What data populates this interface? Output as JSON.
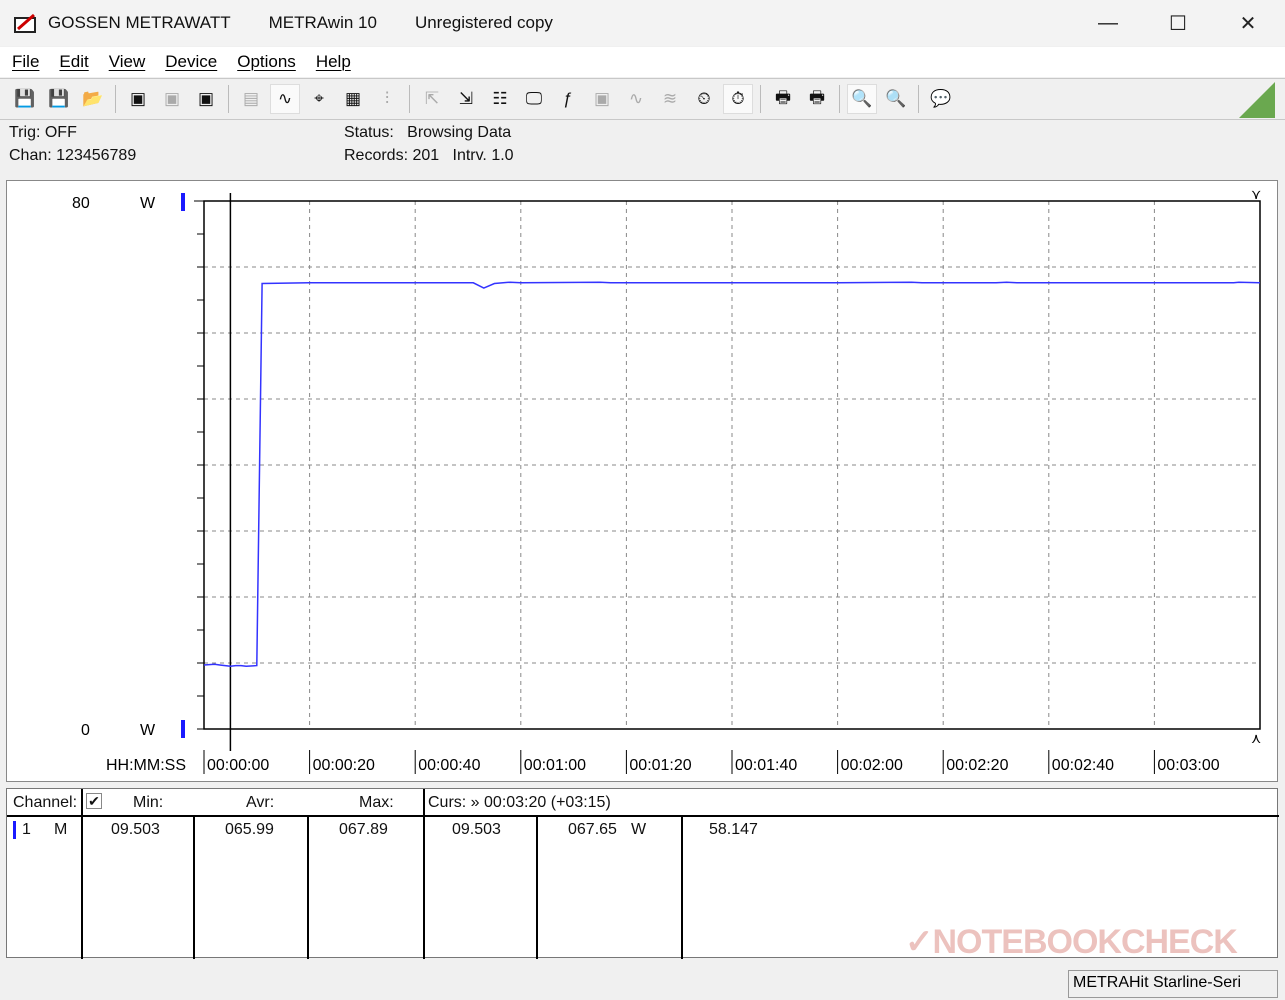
{
  "window": {
    "brand": "GOSSEN METRAWATT",
    "app": "METRAwin 10",
    "registration": "Unregistered copy"
  },
  "menu": [
    "File",
    "Edit",
    "View",
    "Device",
    "Options",
    "Help"
  ],
  "toolbar": [
    {
      "icon": "save-export-icon",
      "glyph": "💾"
    },
    {
      "icon": "save-import-icon",
      "glyph": "💾"
    },
    {
      "icon": "open-folder-icon",
      "glyph": "📂"
    },
    "sep",
    {
      "icon": "device-read-icon",
      "glyph": "▣"
    },
    {
      "icon": "device-read-disabled-icon",
      "glyph": "▣",
      "disabled": true
    },
    {
      "icon": "device-memory-icon",
      "glyph": "▣"
    },
    "sep",
    {
      "icon": "numeric-display-icon",
      "glyph": "▤",
      "disabled": true
    },
    {
      "icon": "waveform-chart-icon",
      "glyph": "∿",
      "active": true
    },
    {
      "icon": "crosshair-cursor-icon",
      "glyph": "⌖"
    },
    {
      "icon": "table-view-icon",
      "glyph": "▦"
    },
    {
      "icon": "histogram-icon",
      "glyph": "⫶",
      "disabled": true
    },
    "sep",
    {
      "icon": "transfer-out-icon",
      "glyph": "⇱",
      "disabled": true
    },
    {
      "icon": "transfer-in-icon",
      "glyph": "⇲"
    },
    {
      "icon": "settings-list-icon",
      "glyph": "☷"
    },
    {
      "icon": "monitor-icon",
      "glyph": "🖵"
    },
    {
      "icon": "formula-icon",
      "glyph": "ƒ"
    },
    {
      "icon": "device-settings-icon",
      "glyph": "▣",
      "disabled": true
    },
    {
      "icon": "trigger-wave-icon",
      "glyph": "∿",
      "disabled": true
    },
    {
      "icon": "signal-wave-icon",
      "glyph": "≋",
      "disabled": true
    },
    {
      "icon": "clock-timer-icon",
      "glyph": "⏲"
    },
    {
      "icon": "record-stopwatch-icon",
      "glyph": "⏱",
      "active": true
    },
    "sep",
    {
      "icon": "print-chart-icon",
      "glyph": "🖶"
    },
    {
      "icon": "print-icon",
      "glyph": "🖶"
    },
    "sep",
    {
      "icon": "zoom-wave-icon",
      "glyph": "🔍",
      "active": true
    },
    {
      "icon": "zoom-peak-icon",
      "glyph": "🔍"
    },
    "sep",
    {
      "icon": "help-comment-icon",
      "glyph": "💬"
    }
  ],
  "info": {
    "trig": "Trig: OFF",
    "chan": "Chan:  123456789",
    "status": "Status:   Browsing Data",
    "records": "Records: 201   Intrv. 1.0"
  },
  "chart_data": {
    "type": "line",
    "ylim": [
      0,
      80
    ],
    "y_top_label": "80",
    "y_bottom_label": "0",
    "y_unit": "W",
    "xlabel": "HH:MM:SS",
    "xlim": [
      0,
      200
    ],
    "x_ticks": [
      "00:00:00",
      "00:00:20",
      "00:00:40",
      "00:01:00",
      "00:01:20",
      "00:01:40",
      "00:02:00",
      "00:02:20",
      "00:02:40",
      "00:03:00"
    ],
    "y_grid_step": 10,
    "grid": true,
    "line_color": "#3333ff",
    "cursor_t": 5,
    "points": [
      [
        0,
        9.7
      ],
      [
        2,
        9.8
      ],
      [
        3,
        9.7
      ],
      [
        4,
        9.6
      ],
      [
        5,
        9.5
      ],
      [
        6,
        9.6
      ],
      [
        7,
        9.6
      ],
      [
        8,
        9.5
      ],
      [
        10,
        9.6
      ],
      [
        11,
        67.5
      ],
      [
        20,
        67.6
      ],
      [
        40,
        67.6
      ],
      [
        51,
        67.6
      ],
      [
        53,
        66.8
      ],
      [
        55,
        67.5
      ],
      [
        58,
        67.7
      ],
      [
        60,
        67.6
      ],
      [
        75,
        67.7
      ],
      [
        77,
        67.6
      ],
      [
        120,
        67.6
      ],
      [
        134,
        67.7
      ],
      [
        136,
        67.6
      ],
      [
        150,
        67.6
      ],
      [
        152,
        67.7
      ],
      [
        154,
        67.6
      ],
      [
        195,
        67.6
      ],
      [
        196,
        67.7
      ],
      [
        200,
        67.6
      ]
    ]
  },
  "table": {
    "headers": {
      "channel": "Channel:",
      "min": "Min:",
      "avr": "Avr:",
      "max": "Max:",
      "curs": "Curs: » 00:03:20 (+03:15)"
    },
    "row": {
      "ch": "1",
      "mode": "M",
      "min": "09.503",
      "avr": "065.99",
      "max": "067.89",
      "curs_val": "09.503",
      "curs2": "067.65",
      "unit": "W",
      "diff": "58.147"
    }
  },
  "statusbar": {
    "device": "METRAHit Starline-Seri"
  },
  "watermark": "NOTEBOOKCHECK"
}
